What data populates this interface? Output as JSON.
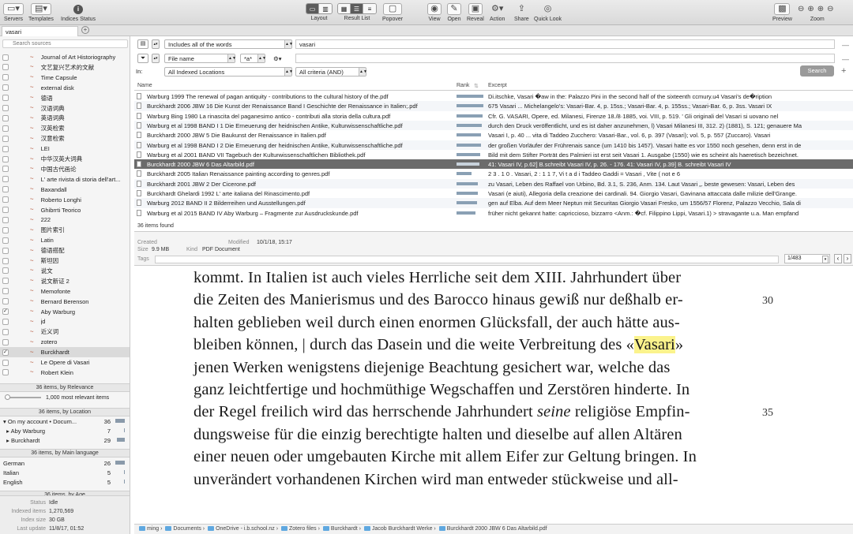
{
  "toolbar": {
    "servers": "Servers",
    "templates": "Templates",
    "indices_status": "Indices Status",
    "layout": "Layout",
    "result_list": "Result List",
    "popover": "Popover",
    "view": "View",
    "open": "Open",
    "reveal": "Reveal",
    "action": "Action",
    "share": "Share",
    "quick_look": "Quick Look",
    "preview": "Preview",
    "zoom": "Zoom"
  },
  "tab": {
    "label": "vasari"
  },
  "sidebar": {
    "search_placeholder": "Search sources",
    "sources": [
      {
        "label": "Journal of Art Historiography",
        "checked": false
      },
      {
        "label": "文艺复兴艺术的文献",
        "checked": false
      },
      {
        "label": "Time Capsule",
        "checked": false
      },
      {
        "label": "external disk",
        "checked": false
      },
      {
        "label": "德语",
        "checked": false
      },
      {
        "label": "汉语词典",
        "checked": false
      },
      {
        "label": "英语词典",
        "checked": false
      },
      {
        "label": "汉英检索",
        "checked": false
      },
      {
        "label": "汉意检索",
        "checked": false
      },
      {
        "label": "LEI",
        "checked": false
      },
      {
        "label": "中华汉英大词典",
        "checked": false
      },
      {
        "label": "中国古代画论",
        "checked": false
      },
      {
        "label": "L' arte rivista di storia dell'art...",
        "checked": false
      },
      {
        "label": "Baxandall",
        "checked": false
      },
      {
        "label": "Roberto Longhi",
        "checked": false
      },
      {
        "label": "Ghibrrti Teorico",
        "checked": false
      },
      {
        "label": "222",
        "checked": false
      },
      {
        "label": "图片索引",
        "checked": false
      },
      {
        "label": "Latin",
        "checked": false
      },
      {
        "label": "德语搭配",
        "checked": false
      },
      {
        "label": "斯坦因",
        "checked": false
      },
      {
        "label": "说文",
        "checked": false
      },
      {
        "label": "说文新证 2",
        "checked": false
      },
      {
        "label": "Memofonte",
        "checked": false
      },
      {
        "label": "Bernard Berenson",
        "checked": false
      },
      {
        "label": "Aby Warburg",
        "checked": true
      },
      {
        "label": "jd",
        "checked": false
      },
      {
        "label": "近义词",
        "checked": false
      },
      {
        "label": "zotero",
        "checked": false
      },
      {
        "label": "Burckhardt",
        "checked": true,
        "selected": true
      },
      {
        "label": "Le Opere di Vasari",
        "checked": false
      },
      {
        "label": "Robert Klein",
        "checked": false
      }
    ],
    "relevance_header": "36 items, by Relevance",
    "relevance_label": "1,000 most relevant items",
    "location_header": "36 items, by Location",
    "locations": [
      {
        "label": "On my account • Docum...",
        "count": "36",
        "fill": 1.0
      },
      {
        "label": "Aby Warburg",
        "count": "7",
        "fill": 0
      },
      {
        "label": "Burckhardt",
        "count": "29",
        "fill": 0.8
      }
    ],
    "language_header": "36 items, by Main language",
    "languages": [
      {
        "label": "German",
        "count": "26",
        "fill": 1.0
      },
      {
        "label": "Italian",
        "count": "5",
        "fill": 0.1
      },
      {
        "label": "English",
        "count": "5",
        "fill": 0.1
      }
    ],
    "age_header": "36 items, by Age",
    "status": {
      "status_k": "Status",
      "status_v": "Idle",
      "indexed_k": "Indexed items",
      "indexed_v": "1,270,569",
      "size_k": "Index size",
      "size_v": "30 GB",
      "update_k": "Last update",
      "update_v": "11/8/17, 01:52"
    }
  },
  "query": {
    "mode": "Includes all of the words",
    "term": "vasari",
    "field": "File name",
    "field_op": "*a*",
    "scope_label": "In:",
    "scope": "All Indexed Locations",
    "criteria": "All criteria (AND)",
    "search_button": "Search"
  },
  "results": {
    "columns": {
      "name": "Name",
      "rank": "Rank",
      "excerpt": "Excerpt"
    },
    "rows": [
      {
        "name": "Warburg 1999 The renewal of pagan antiquity - contributions to the cultural history of the.pdf",
        "rank": 1.0,
        "excerpt": "Di.itschke, Vasari �aw in the: Palazzo Pini in the second half of the sixteenth ccmury.u4 Vasari's de�ription"
      },
      {
        "name": "Burckhardt 2006 JBW 16 Die Kunst der Renaissance Band I Geschichte der Renaissance in Italien;.pdf",
        "rank": 1.0,
        "excerpt": "675 Vasari ... Michelangelo's: Vasari-Bar. 4, p. 15ss.; Vasari-Bar. 4, p. 155ss.; Vasari-Bar. 6, p. 3ss. Vasari IX"
      },
      {
        "name": "Warburg Bing 1980 La rinascita del paganesimo antico - contributi alla storia della cultura.pdf",
        "rank": 0.97,
        "excerpt": "Cfr. G. VASARI, Opere, ed. Milanesi, Firenze 18./8·1885, voi. VIII, p. 519. ' Gli originali del Vasari si uovano nel"
      },
      {
        "name": "Warburg et al 1998 BAND I 1 Die Erneuerung der heidnischen Antike, Kulturwissenschaftliche.pdf",
        "rank": 0.95,
        "excerpt": "durch den Druck veröffentlicht, und es ist daher anzunehmen, l) Vasari Milanesi III, 312. 2) (1881), S. 121; genauere Ma"
      },
      {
        "name": "Burckhardt 2000 JBW 5 Die Baukunst der Renaissance in Italien.pdf",
        "rank": 0.92,
        "excerpt": "Vasari I, p. 40 ... vita di Taddeo Zuccherо: Vasari-Bar., vol. 6, p. 397 (Vasari); vol. 5, p. 557 (Zuccaro). Vasari"
      },
      {
        "name": "Warburg et al 1998 BAND I 2 Die Erneuerung der heidnischen Antike, Kulturwissenschaftliche.pdf",
        "rank": 0.9,
        "excerpt": "der großen Vorläufer der Frührenais sance (um 1410 bis 1457). Vasari hatte es vor 1550 noch gesehen, denn erst in de"
      },
      {
        "name": "Warburg et al 2001 BAND VII Tagebuch der Kulturwissenschaftlichen Bibliothek.pdf",
        "rank": 0.88,
        "excerpt": "Bild mit dem Stifter Porträt des Palmieri ist erst seit Vasari 1. Ausgabe (1550) wie es scheint als haeretisch bezeichnet."
      },
      {
        "name": "Burckhardt 2000 JBW 6 Das Altarbild.pdf",
        "rank": 0.85,
        "excerpt": "41: Vasari IV, p.62] B.schreibt Vasari IV, p. 26. - 176. 41: Vasari IV, p.39] B. schreibt Vasari IV",
        "selected": true
      },
      {
        "name": "Burckhardt 2005 Italian Renaissance painting according to genres.pdf",
        "rank": 0.55,
        "excerpt": "2 3 . 1 0 . Vasari, 2 : 1 1 7, Vi t a d i Taddeo Gaddi = Vasari , Vite ( not e 6"
      },
      {
        "name": "Burckhardt 2001 JBW 2 Der Cicerone.pdf",
        "rank": 0.8,
        "excerpt": "zu Vasari, Leben des Raffael von Urbino, Bd. 3.1, S. 236, Anm. 134. Laut Vasari „. beste gewesen: Vasari, Leben des"
      },
      {
        "name": "Burckhardt Ghelardi 1992 L' arte italiana del Rinascimento.pdf",
        "rank": 0.78,
        "excerpt": "Vasari (e aiuti), Allegoria della creazione dei cardinali. 94. Giorgio Vasari, Gavinana attaccata dalle milizie dell'Grange."
      },
      {
        "name": "Warburg 2012 BAND II 2 Bilderreihen und Ausstellungen.pdf",
        "rank": 0.75,
        "excerpt": "gen auf Elba. Auf dem Meer Neptun mit Securitas Giorgio Vasari Fresko, um 1556/57 Florenz, Palazzo Vecchio, Sala di"
      },
      {
        "name": "Warburg et al 2015 BAND IV Aby Warburg – Fragmente zur Ausdruckskunde.pdf",
        "rank": 0.72,
        "excerpt": "früher nicht gekannt hatte: capriccioso, bizzarro <Anm.: �cf. Filippino Lippi, Vasari.1) > stravagante u.a. Man empfand"
      }
    ],
    "found": "36 items found"
  },
  "meta": {
    "created_k": "Created",
    "created_v": "",
    "modified_k": "Modified",
    "modified_v": "10/1/18, 15:17",
    "size_k": "Size",
    "size_v": "9.9 MB",
    "kind_k": "Kind",
    "kind_v": "PDF Document",
    "tags_k": "Tags",
    "page": "1/483"
  },
  "preview": {
    "lines": [
      {
        "pre": "kommt. In Italien ist auch vieles Herrliche seit dem XIII. Jahrhundert über",
        "hl": "",
        "post": "",
        "num": ""
      },
      {
        "pre": "die Zeiten des Manierismus und des Barocco hinaus gewiß nur deßhalb er-",
        "hl": "",
        "post": "",
        "num": "30"
      },
      {
        "pre": "halten geblieben weil durch einen enormen Glücksfall, der auch hätte aus-",
        "hl": "",
        "post": "",
        "num": ""
      },
      {
        "pre": "bleiben können, | durch das Dasein und die weite Verbreitung des «",
        "hl": "Vasari",
        "post": "»",
        "num": ""
      },
      {
        "pre": "jenen Werken wenigstens diejenige Beachtung gesichert war, welche das",
        "hl": "",
        "post": "",
        "num": ""
      },
      {
        "pre": "ganz leichtfertige und hochmüthige Wegschaffen und Zerstören hinderte. In",
        "hl": "",
        "post": "",
        "num": ""
      },
      {
        "pre": "der Regel freilich wird das herrschende Jahrhundert ",
        "it": "seine",
        "post2": " religiöse Empfin-",
        "hl": "",
        "post": "",
        "num": "35"
      },
      {
        "pre": "dungsweise für die einzig berechtigte halten und dieselbe auf allen Altären",
        "hl": "",
        "post": "",
        "num": ""
      },
      {
        "pre": "einer neuen oder umgebauten Kirche mit allem Eifer zur Geltung bringen. In",
        "hl": "",
        "post": "",
        "num": ""
      },
      {
        "pre": "unverändert vorhandenen Kirchen wird man entweder stückweise und all-",
        "hl": "",
        "post": "",
        "num": ""
      }
    ]
  },
  "path": [
    "ming",
    "Documents",
    "OneDrive - i.b.school.nz",
    "Zotero files",
    "Burckhardt",
    "Jacob Burckhardt Werke",
    "Burckhardt 2000 JBW 6 Das Altarbild.pdf"
  ]
}
